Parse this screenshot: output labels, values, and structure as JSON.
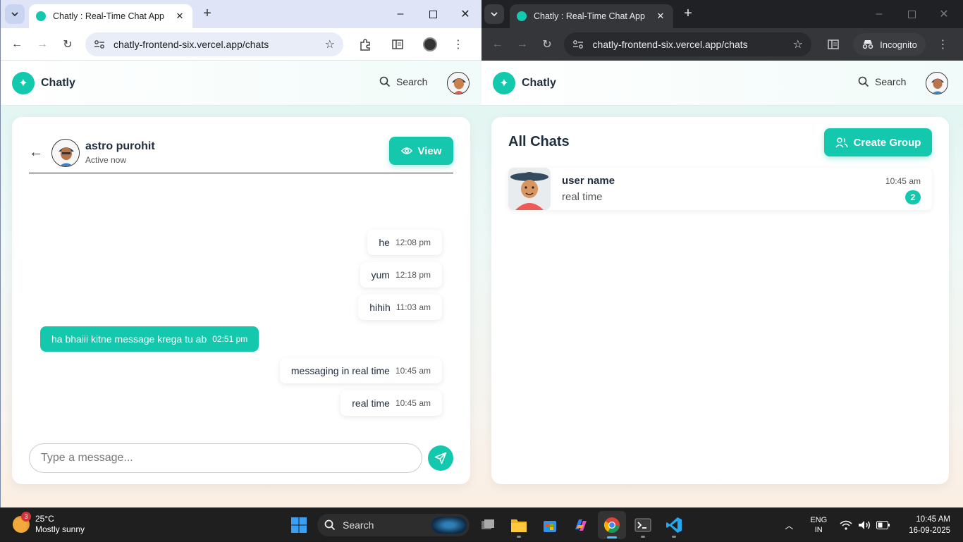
{
  "left_window": {
    "tab_title": "Chatly : Real-Time Chat App",
    "url": "chatly-frontend-six.vercel.app/chats"
  },
  "right_window": {
    "tab_title": "Chatly : Real-Time Chat App",
    "url": "chatly-frontend-six.vercel.app/chats",
    "incognito_label": "Incognito"
  },
  "app": {
    "brand": "Chatly",
    "search_label": "Search"
  },
  "chat": {
    "peer_name": "astro purohit",
    "peer_status": "Active now",
    "view_label": "View",
    "messages": [
      {
        "text": "he",
        "time": "12:08 pm",
        "dir": "in"
      },
      {
        "text": "yum",
        "time": "12:18 pm",
        "dir": "in"
      },
      {
        "text": "hihih",
        "time": "11:03 am",
        "dir": "in"
      },
      {
        "text": "ha bhaiii kitne message krega tu ab",
        "time": "02:51 pm",
        "dir": "out"
      },
      {
        "text": "messaging in real time",
        "time": "10:45 am",
        "dir": "in"
      },
      {
        "text": "real time",
        "time": "10:45 am",
        "dir": "in"
      }
    ],
    "input_placeholder": "Type a message..."
  },
  "chat_list": {
    "title": "All Chats",
    "create_group_label": "Create Group",
    "items": [
      {
        "name": "user name",
        "preview": "real time",
        "time": "10:45 am",
        "unread": "2"
      }
    ]
  },
  "taskbar": {
    "weather_temp": "25°C",
    "weather_desc": "Mostly sunny",
    "weather_badge": "3",
    "search_label": "Search",
    "lang_1": "ENG",
    "lang_2": "IN",
    "time": "10:45 AM",
    "date": "16-09-2025"
  },
  "colors": {
    "accent": "#14c8ae",
    "left_tabstrip": "#dfe5f7",
    "right_tabstrip": "#202124"
  }
}
